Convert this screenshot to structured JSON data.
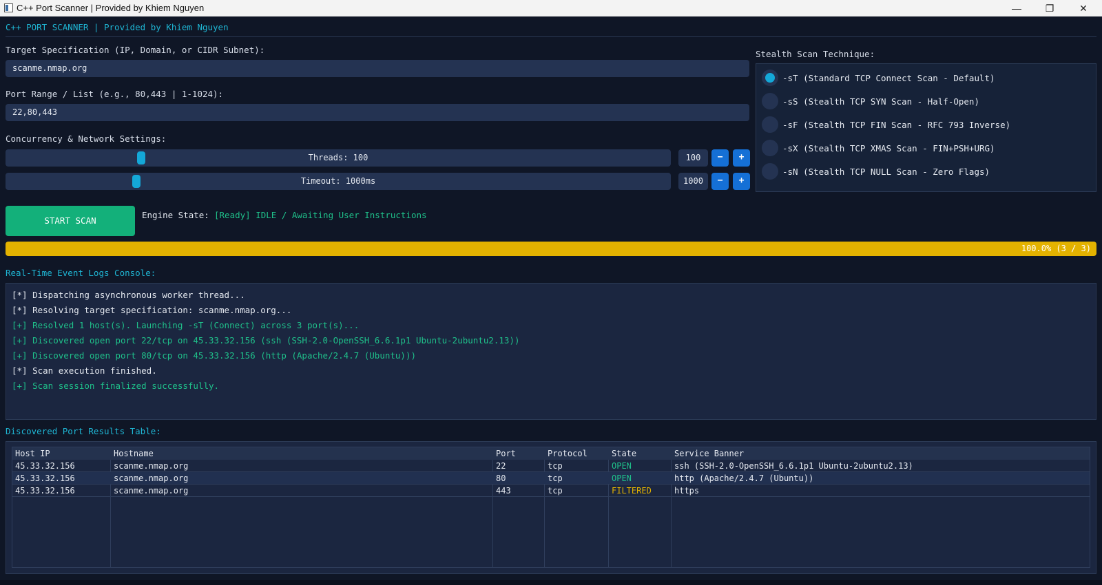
{
  "window": {
    "title": "C++ Port Scanner | Provided by Khiem Nguyen",
    "minimize": "—",
    "maximize": "❐",
    "close": "✕"
  },
  "header": "C++ PORT SCANNER | Provided by Khiem Nguyen",
  "target": {
    "label": "Target Specification (IP, Domain, or CIDR Subnet):",
    "value": "scanme.nmap.org"
  },
  "ports": {
    "label": "Port Range / List (e.g., 80,443 | 1-1024):",
    "value": "22,80,443"
  },
  "settings": {
    "label": "Concurrency & Network Settings:",
    "threads": {
      "text": "Threads: 100",
      "value": "100",
      "level": 0.2
    },
    "timeout": {
      "text": "Timeout: 1000ms",
      "value": "1000",
      "level": 0.193
    },
    "minus": "−",
    "plus": "+"
  },
  "stealth": {
    "label": "Stealth Scan Technique:",
    "options": [
      {
        "label": "-sT (Standard TCP Connect Scan - Default)",
        "selected": true
      },
      {
        "label": "-sS (Stealth TCP SYN Scan - Half-Open)",
        "selected": false
      },
      {
        "label": "-sF (Stealth TCP FIN Scan - RFC 793 Inverse)",
        "selected": false
      },
      {
        "label": "-sX (Stealth TCP XMAS Scan - FIN+PSH+URG)",
        "selected": false
      },
      {
        "label": "-sN (Stealth TCP NULL Scan - Zero Flags)",
        "selected": false
      }
    ]
  },
  "start_button": "START SCAN",
  "engine": {
    "label": "Engine State:",
    "state": "[Ready] IDLE / Awaiting User Instructions"
  },
  "progress": {
    "text": "100.0% (3 / 3)",
    "fraction": 1.0
  },
  "logs": {
    "title": "Real-Time Event Logs Console:",
    "lines": [
      {
        "text": "[*] Dispatching asynchronous worker thread...",
        "kind": "info"
      },
      {
        "text": "[*] Resolving target specification: scanme.nmap.org...",
        "kind": "info"
      },
      {
        "text": "[+] Resolved 1 host(s). Launching -sT (Connect) across 3 port(s)...",
        "kind": "ok"
      },
      {
        "text": "[+] Discovered open port 22/tcp on 45.33.32.156 (ssh (SSH-2.0-OpenSSH_6.6.1p1 Ubuntu-2ubuntu2.13))",
        "kind": "ok"
      },
      {
        "text": "[+] Discovered open port 80/tcp on 45.33.32.156 (http (Apache/2.4.7 (Ubuntu)))",
        "kind": "ok"
      },
      {
        "text": "[*] Scan execution finished.",
        "kind": "info"
      },
      {
        "text": "[+] Scan session finalized successfully.",
        "kind": "ok"
      }
    ]
  },
  "results": {
    "title": "Discovered Port Results Table:",
    "columns": [
      "Host IP",
      "Hostname",
      "Port",
      "Protocol",
      "State",
      "Service Banner"
    ],
    "rows": [
      [
        "45.33.32.156",
        "scanme.nmap.org",
        "22",
        "tcp",
        "OPEN",
        "ssh (SSH-2.0-OpenSSH_6.6.1p1 Ubuntu-2ubuntu2.13)"
      ],
      [
        "45.33.32.156",
        "scanme.nmap.org",
        "80",
        "tcp",
        "OPEN",
        "http (Apache/2.4.7 (Ubuntu))"
      ],
      [
        "45.33.32.156",
        "scanme.nmap.org",
        "443",
        "tcp",
        "FILTERED",
        "https"
      ]
    ],
    "state_colors": {
      "OPEN": "#1fc08a",
      "FILTERED": "#e3b200"
    }
  },
  "colors": {
    "accent": "#1fb6d4",
    "success": "#13b07a",
    "progress": "#e3b200",
    "background": "#0f1626"
  }
}
